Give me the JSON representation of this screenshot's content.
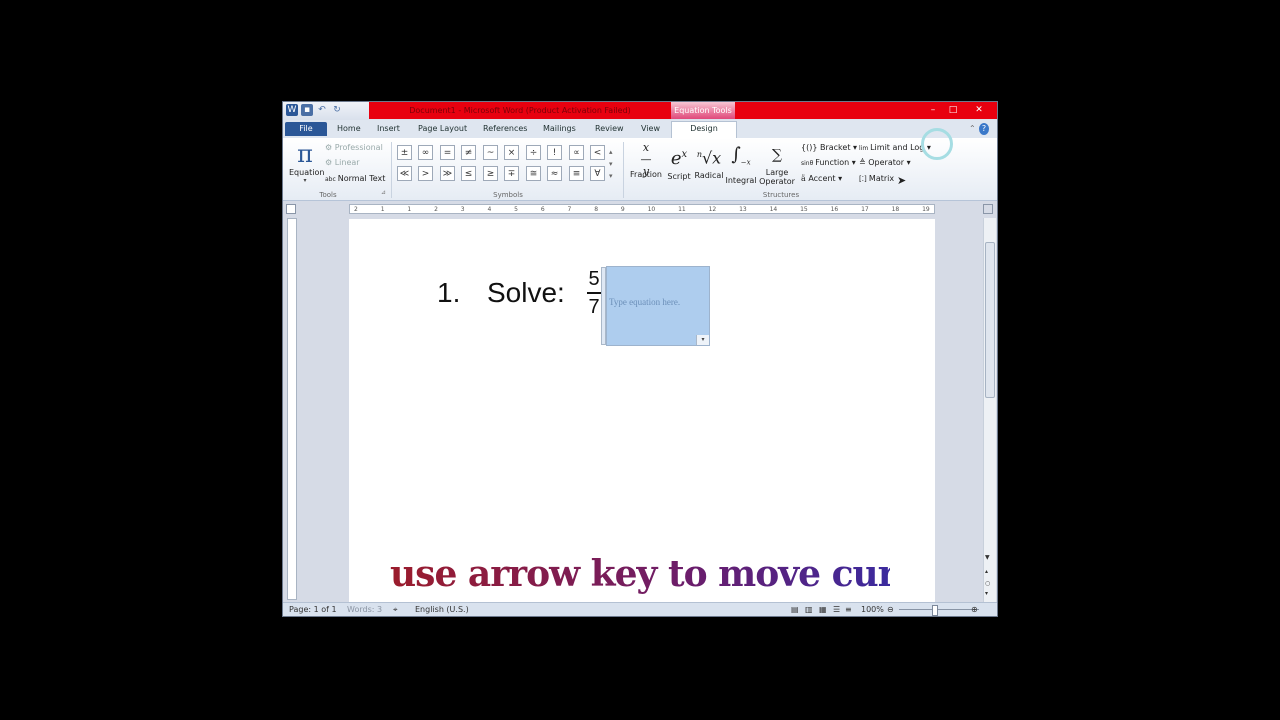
{
  "window": {
    "title": "Document1 - Microsoft Word (Product Activation Failed)",
    "context_tab_group": "Equation Tools"
  },
  "tabs": [
    "File",
    "Home",
    "Insert",
    "Page Layout",
    "References",
    "Mailings",
    "Review",
    "View",
    "Design"
  ],
  "ribbon": {
    "tools": {
      "equation_label": "Equation",
      "professional_label": "Professional",
      "linear_label": "Linear",
      "normal_text_label": "Normal Text",
      "group_label": "Tools"
    },
    "symbols": {
      "row1": [
        "±",
        "∞",
        "=",
        "≠",
        "~",
        "×",
        "÷",
        "!",
        "∝",
        "<"
      ],
      "row2": [
        "≪",
        ">",
        "≫",
        "≤",
        "≥",
        "∓",
        "≅",
        "≈",
        "≡",
        "∀"
      ],
      "group_label": "Symbols"
    },
    "structures": {
      "fraction_label": "Fraction",
      "script_label": "Script",
      "radical_label": "Radical",
      "integral_label": "Integral",
      "large_operator_label": "Large Operator",
      "bracket_label": "Bracket",
      "function_label": "Function",
      "accent_label": "Accent",
      "limit_label": "Limit and Log",
      "operator_label": "Operator",
      "matrix_label": "Matrix",
      "group_label": "Structures"
    }
  },
  "ruler": {
    "numbers": [
      "2",
      "1",
      "1",
      "2",
      "3",
      "4",
      "5",
      "6",
      "7",
      "8",
      "9",
      "10",
      "11",
      "12",
      "13",
      "14",
      "15",
      "16",
      "17",
      "18",
      "19"
    ]
  },
  "document": {
    "list_number": "1.",
    "solve_label": "Solve:",
    "fraction_numerator": "5",
    "fraction_denominator": "7",
    "equation_placeholder": "Type equation here."
  },
  "status_bar": {
    "page": "Page: 1 of 1",
    "words": "Words: 3",
    "language": "English (U.S.)",
    "zoom": "100%"
  },
  "overlay_caption": "use arrow key to move cursor"
}
